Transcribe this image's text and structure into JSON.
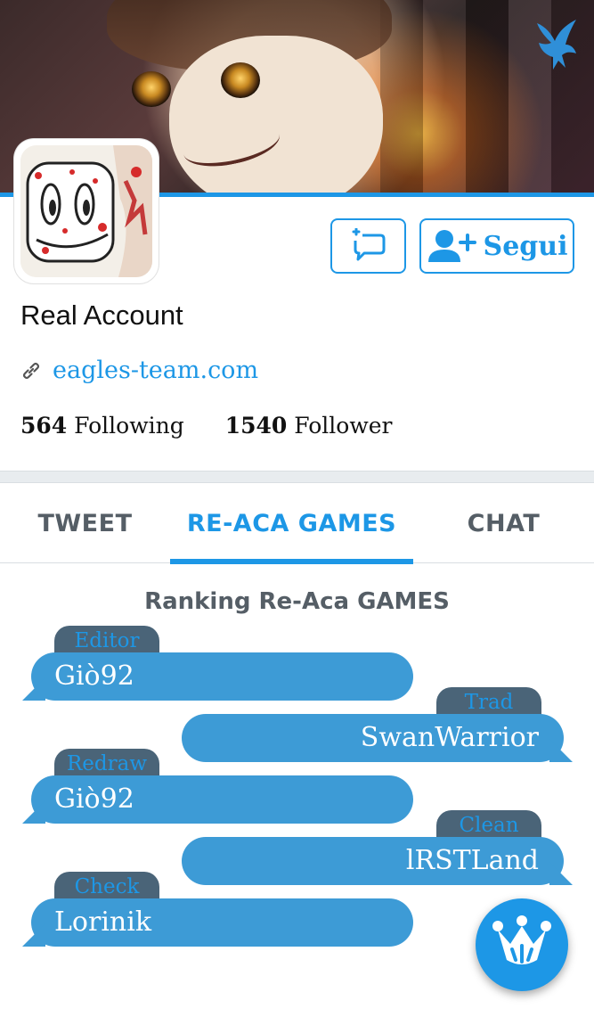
{
  "profile": {
    "name": "Real Account",
    "website": "eagles-team.com",
    "following_count": "564",
    "following_label": "Following",
    "follower_count": "1540",
    "follower_label": "Follower"
  },
  "actions": {
    "follow_label": "Segui"
  },
  "tabs": [
    {
      "label": "TWEET",
      "active": false
    },
    {
      "label": "RE-ACA GAMES",
      "active": true
    },
    {
      "label": "CHAT",
      "active": false
    }
  ],
  "ranking": {
    "title": "Ranking Re-Aca GAMES",
    "entries": [
      {
        "role": "Editor",
        "name": "Giò92",
        "side": "left"
      },
      {
        "role": "Trad",
        "name": "SwanWarrior",
        "side": "right"
      },
      {
        "role": "Redraw",
        "name": "Giò92",
        "side": "left"
      },
      {
        "role": "Clean",
        "name": "lRSTLand",
        "side": "right"
      },
      {
        "role": "Check",
        "name": "Lorinik",
        "side": "left"
      }
    ]
  },
  "colors": {
    "accent": "#1d97e6",
    "bubble": "#3d9bd6",
    "tag": "#4a6478",
    "tab_inactive": "#555e66"
  },
  "icons": {
    "banner_logo": "eagle-icon",
    "message_button": "new-message-icon",
    "follow_button": "add-user-icon",
    "website": "link-icon",
    "fab": "crown-icon"
  }
}
